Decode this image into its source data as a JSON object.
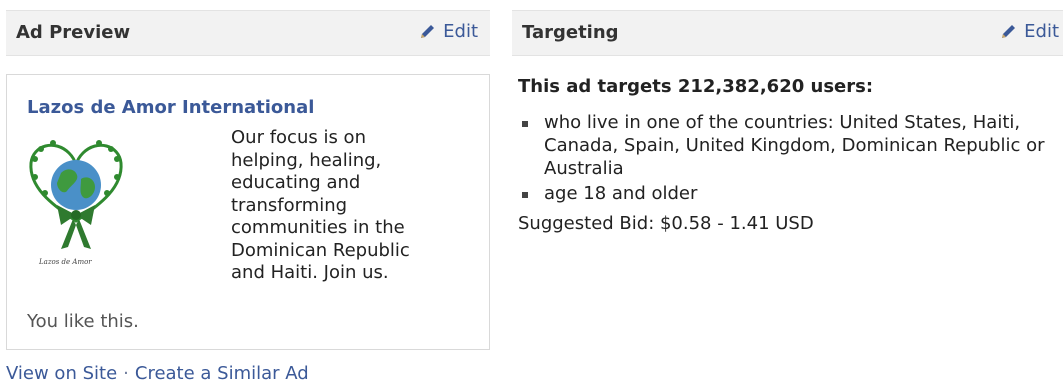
{
  "ad_preview": {
    "header_title": "Ad Preview",
    "edit_label": "Edit",
    "ad_title": "Lazos de Amor International",
    "ad_body": "Our focus is on\nhelping, healing,\neducating and\ntransforming\ncommunities in the\nDominican Republic\nand Haiti. Join us.",
    "like_text": "You like this.",
    "image_caption": "Lazos de Amor",
    "links": {
      "view_on_site": "View on Site",
      "separator": "·",
      "create_similar": "Create a Similar Ad"
    }
  },
  "targeting": {
    "header_title": "Targeting",
    "edit_label": "Edit",
    "headline": "This ad targets 212,382,620 users:",
    "criteria": [
      "who live in one of the countries: United States, Haiti, Canada, Spain, United Kingdom, Dominican Republic or Australia",
      "age 18 and older"
    ],
    "suggested_bid": "Suggested Bid: $0.58 - 1.41 USD"
  },
  "colors": {
    "link": "#3b5998",
    "header_bg": "#f2f2f2",
    "logo_green": "#2f8a2f",
    "logo_blue": "#4a90c8"
  }
}
